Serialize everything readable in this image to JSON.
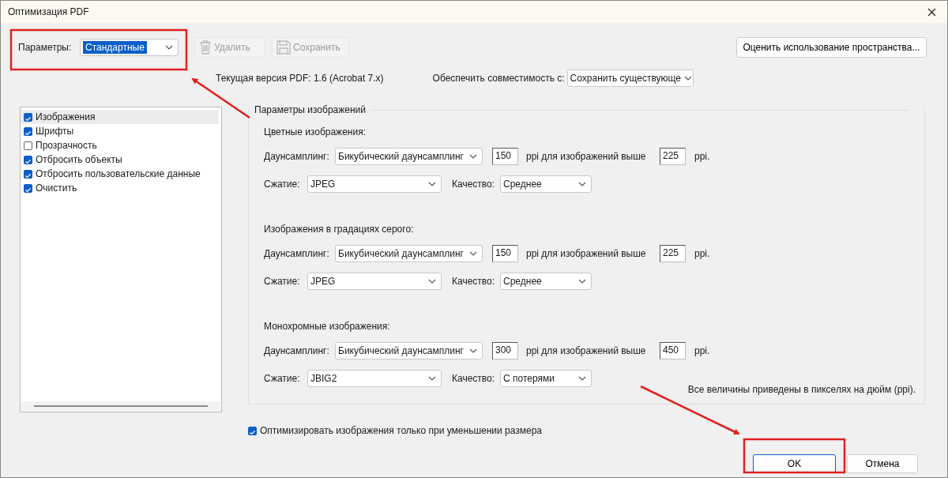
{
  "window": {
    "title": "Оптимизация PDF"
  },
  "preset": {
    "label": "Параметры:",
    "value": "Стандартные"
  },
  "toolbar_buttons": [
    {
      "label": "Удалить",
      "kind": "delete",
      "disabled": true
    },
    {
      "label": "Сохранить",
      "kind": "save",
      "disabled": true
    }
  ],
  "audit_button": "Оценить использование пространства...",
  "version_text": "Текущая версия PDF: 1.6 (Acrobat 7.x)",
  "compat": {
    "label": "Обеспечить совместимость с:",
    "value": "Сохранить существующе"
  },
  "categories": [
    {
      "label": "Изображения",
      "checked": true,
      "selected": true
    },
    {
      "label": "Шрифты",
      "checked": true,
      "selected": false
    },
    {
      "label": "Прозрачность",
      "checked": false,
      "selected": false
    },
    {
      "label": "Отбросить объекты",
      "checked": true,
      "selected": false
    },
    {
      "label": "Отбросить пользовательские данные",
      "checked": true,
      "selected": false
    },
    {
      "label": "Очистить",
      "checked": true,
      "selected": false
    }
  ],
  "image_settings": {
    "title": "Параметры изображений",
    "sections": [
      {
        "heading": "Цветные изображения:",
        "downsampling_label": "Даунсамплинг:",
        "downsampling_method": "Бикубический даунсамплинг",
        "resolution": "150",
        "threshold_label": "ppi для изображений выше",
        "threshold": "225",
        "unit": "ppi.",
        "compression_label": "Сжатие:",
        "compression": "JPEG",
        "quality_label": "Качество:",
        "quality": "Среднее"
      },
      {
        "heading": "Изображения в градациях серого:",
        "downsampling_label": "Даунсамплинг:",
        "downsampling_method": "Бикубический даунсамплинг",
        "resolution": "150",
        "threshold_label": "ppi для изображений выше",
        "threshold": "225",
        "unit": "ppi.",
        "compression_label": "Сжатие:",
        "compression": "JPEG",
        "quality_label": "Качество:",
        "quality": "Среднее"
      },
      {
        "heading": "Монохромные изображения:",
        "downsampling_label": "Даунсамплинг:",
        "downsampling_method": "Бикубический даунсамплинг",
        "resolution": "300",
        "threshold_label": "ppi для изображений выше",
        "threshold": "450",
        "unit": "ppi.",
        "compression_label": "Сжатие:",
        "compression": "JBIG2",
        "quality_label": "Качество:",
        "quality": "С потерями"
      }
    ],
    "note": "Все величины приведены в пикселях на дюйм (ppi)."
  },
  "optimize_checkbox": {
    "label": "Оптимизировать изображения только при уменьшении размера",
    "checked": true
  },
  "buttons": [
    {
      "label": "OK",
      "default": true
    },
    {
      "label": "Отмена",
      "default": false
    }
  ]
}
